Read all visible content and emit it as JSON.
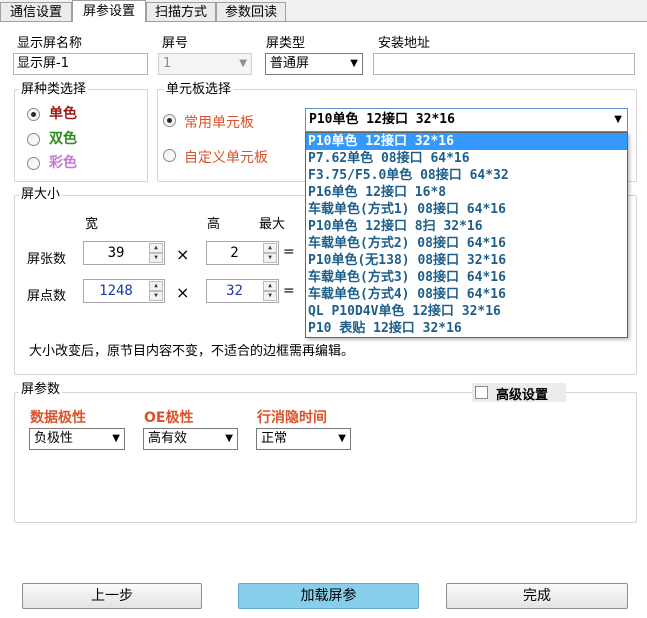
{
  "tabs": [
    {
      "label": "通信设置"
    },
    {
      "label": "屏参设置"
    },
    {
      "label": "扫描方式"
    },
    {
      "label": "参数回读"
    }
  ],
  "screen_info": {
    "name_label": "显示屏名称",
    "name_value": "显示屏-1",
    "number_label": "屏号",
    "number_value": "1",
    "type_label": "屏类型",
    "type_value": "普通屏",
    "address_label": "安装地址",
    "address_value": ""
  },
  "color_group": {
    "title": "屏种类选择",
    "options": [
      {
        "label": "单色",
        "color": "#9a1a1a",
        "checked": true
      },
      {
        "label": "双色",
        "color": "#2f8a1f",
        "checked": false
      },
      {
        "label": "彩色",
        "color": "#c27bd1",
        "checked": false
      }
    ]
  },
  "unit_group": {
    "title": "单元板选择",
    "common_label": "常用单元板",
    "custom_label": "自定义单元板",
    "selected": "P10单色 12接口 32*16",
    "options": [
      "P10单色 12接口 32*16",
      "P7.62单色 08接口 64*16",
      "F3.75/F5.0单色 08接口 64*32",
      "P16单色 12接口 16*8",
      "车载单色(方式1) 08接口 64*16",
      "P10单色 12接口 8扫 32*16",
      "车载单色(方式2) 08接口 64*16",
      "P10单色(无138) 08接口 32*16",
      "车载单色(方式3) 08接口 64*16",
      "车载单色(方式4) 08接口 64*16",
      "QL P10D4V单色 12接口 32*16",
      "P10 表贴 12接口 32*16"
    ]
  },
  "size_group": {
    "title": "屏大小",
    "col_width": "宽",
    "col_height": "高",
    "col_max": "最大",
    "row_count_label": "屏张数",
    "count_width": "39",
    "count_height": "2",
    "row_pixel_label": "屏点数",
    "pixel_width": "1248",
    "pixel_height": "32",
    "times": "×",
    "equals": "=",
    "note": "大小改变后，原节目内容不变，不适合的边框需再编辑。"
  },
  "param_group": {
    "title": "屏参数",
    "advanced_label": "高级设置",
    "data_polarity_label": "数据极性",
    "data_polarity_value": "负极性",
    "oe_polarity_label": "OE极性",
    "oe_polarity_value": "高有效",
    "blank_time_label": "行消隐时间",
    "blank_time_value": "正常"
  },
  "buttons": {
    "prev": "上一步",
    "load": "加载屏参",
    "finish": "完成"
  }
}
